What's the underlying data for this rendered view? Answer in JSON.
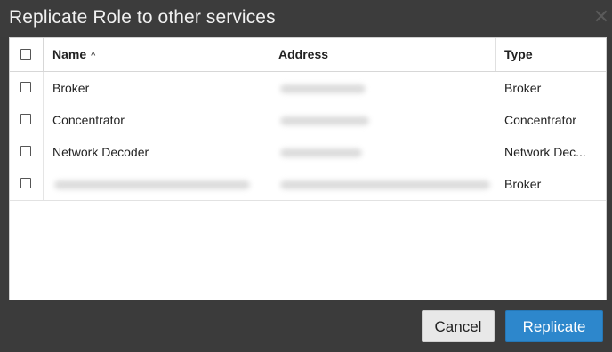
{
  "dialog": {
    "title": "Replicate Role to other services",
    "close_glyph": "✕"
  },
  "table": {
    "headers": {
      "name": "Name",
      "sort_indicator": "^",
      "address": "Address",
      "type": "Type"
    },
    "rows": [
      {
        "name": "Broker",
        "address_blurred": true,
        "type": "Broker"
      },
      {
        "name": "Concentrator",
        "address_blurred": true,
        "type": "Concentrator"
      },
      {
        "name": "Network Decoder",
        "address_blurred": true,
        "type": "Network Dec..."
      },
      {
        "name_blurred": true,
        "address_blurred": true,
        "type": "Broker"
      }
    ]
  },
  "footer": {
    "cancel_label": "Cancel",
    "replicate_label": "Replicate"
  },
  "colors": {
    "dialog_bg": "#3b3b3b",
    "primary_button": "#2d87cc",
    "secondary_button": "#e8e8e8"
  }
}
